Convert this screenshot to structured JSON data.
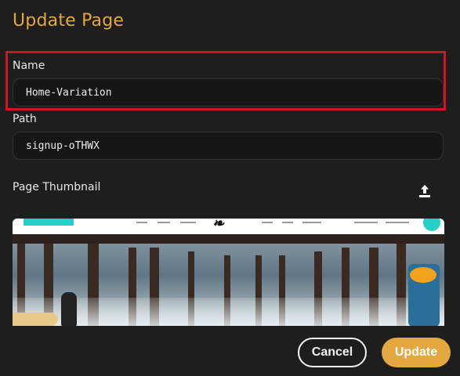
{
  "dialog": {
    "title": "Update Page"
  },
  "form": {
    "name_label": "Name",
    "name_value": "Home-Variation",
    "path_label": "Path",
    "path_value": "signup-oTHWX",
    "thumbnail_label": "Page Thumbnail"
  },
  "actions": {
    "cancel_label": "Cancel",
    "update_label": "Update"
  },
  "colors": {
    "accent": "#e3a83f",
    "highlight": "#d3141f",
    "background": "#1e1e1e"
  },
  "icons": {
    "upload": "upload-icon"
  }
}
